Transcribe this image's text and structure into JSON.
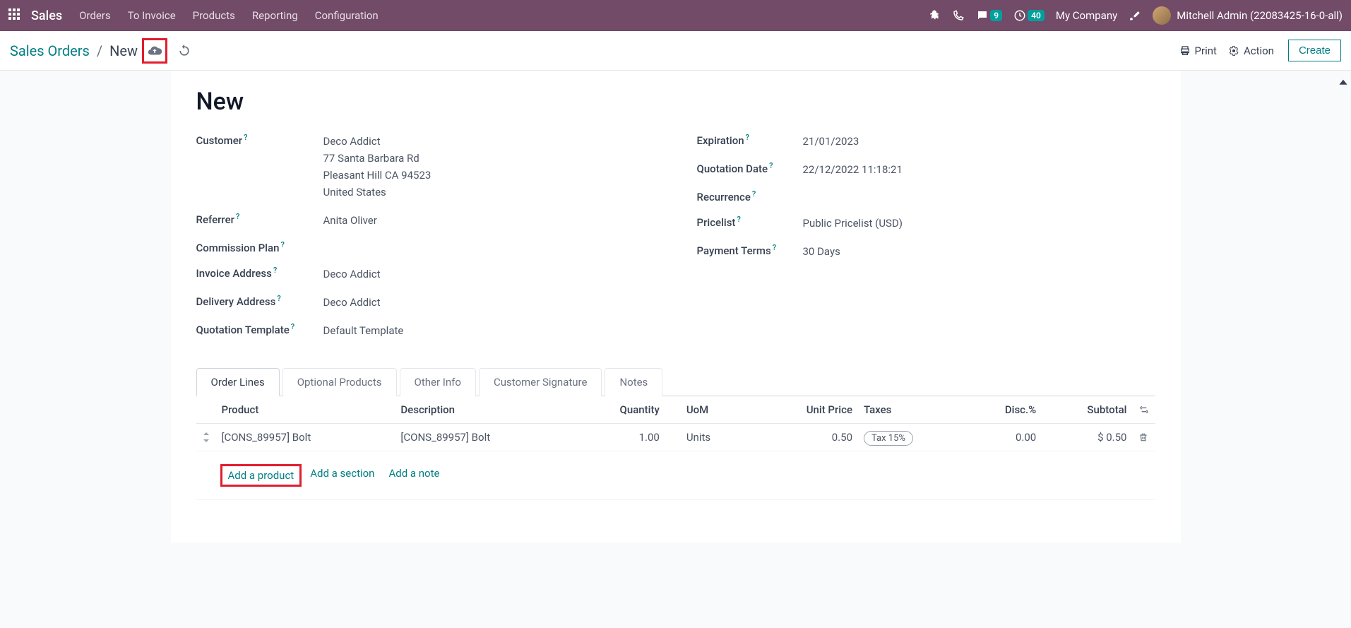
{
  "topnav": {
    "brand": "Sales",
    "menu": [
      "Orders",
      "To Invoice",
      "Products",
      "Reporting",
      "Configuration"
    ],
    "messages_badge": "9",
    "activities_badge": "40",
    "company": "My Company",
    "user": "Mitchell Admin (22083425-16-0-all)"
  },
  "breadcrumb": {
    "root": "Sales Orders",
    "current": "New"
  },
  "controls": {
    "print": "Print",
    "action": "Action",
    "create": "Create"
  },
  "form": {
    "title": "New",
    "left": {
      "customer_label": "Customer",
      "customer_name": "Deco Addict",
      "customer_street": "77 Santa Barbara Rd",
      "customer_city": "Pleasant Hill CA 94523",
      "customer_country": "United States",
      "referrer_label": "Referrer",
      "referrer_value": "Anita Oliver",
      "commission_label": "Commission Plan",
      "invoice_addr_label": "Invoice Address",
      "invoice_addr_value": "Deco Addict",
      "delivery_addr_label": "Delivery Address",
      "delivery_addr_value": "Deco Addict",
      "template_label": "Quotation Template",
      "template_value": "Default Template"
    },
    "right": {
      "expiration_label": "Expiration",
      "expiration_value": "21/01/2023",
      "quotation_date_label": "Quotation Date",
      "quotation_date_value": "22/12/2022 11:18:21",
      "recurrence_label": "Recurrence",
      "pricelist_label": "Pricelist",
      "pricelist_value": "Public Pricelist (USD)",
      "payment_terms_label": "Payment Terms",
      "payment_terms_value": "30 Days"
    }
  },
  "tabs": [
    "Order Lines",
    "Optional Products",
    "Other Info",
    "Customer Signature",
    "Notes"
  ],
  "table": {
    "headers": {
      "product": "Product",
      "description": "Description",
      "quantity": "Quantity",
      "uom": "UoM",
      "unit_price": "Unit Price",
      "taxes": "Taxes",
      "disc": "Disc.%",
      "subtotal": "Subtotal"
    },
    "rows": [
      {
        "product": "[CONS_89957] Bolt",
        "description": "[CONS_89957] Bolt",
        "quantity": "1.00",
        "uom": "Units",
        "unit_price": "0.50",
        "taxes": "Tax 15%",
        "disc": "0.00",
        "subtotal": "$ 0.50"
      }
    ],
    "add_product": "Add a product",
    "add_section": "Add a section",
    "add_note": "Add a note"
  }
}
